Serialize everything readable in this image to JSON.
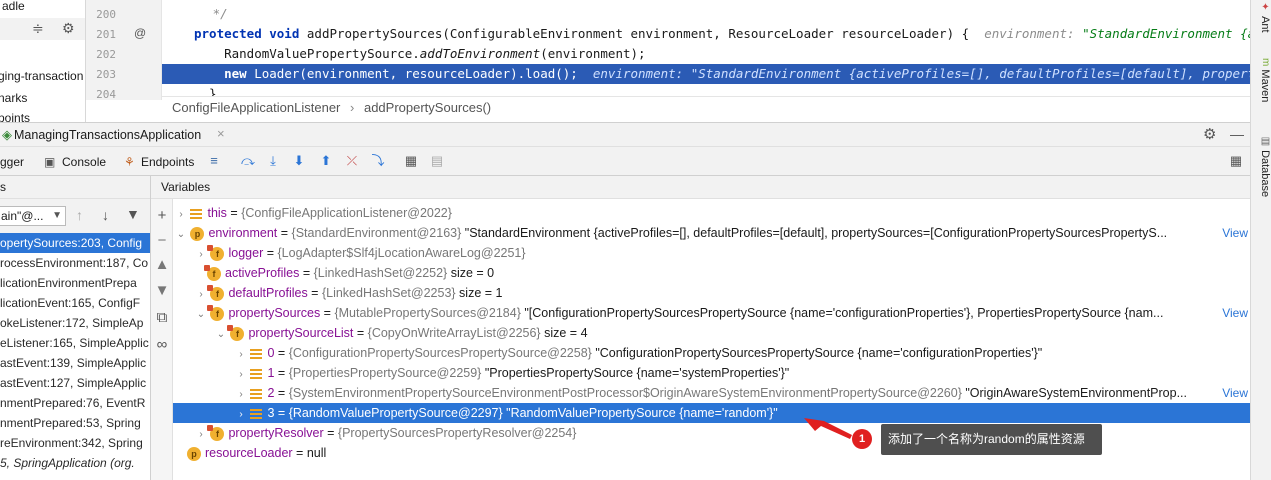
{
  "project_panel": {
    "rows": [
      "adle",
      "",
      "ging-transaction",
      "narks",
      "points"
    ]
  },
  "editor": {
    "line_numbers": [
      "200",
      "201",
      "202",
      "203",
      "204"
    ],
    "gutter_marker": "@",
    "lines": [
      {
        "text": "   */"
      },
      {
        "kw": "protected void ",
        "text": "addPropertySources(ConfigurableEnvironment environment, ResourceLoader resourceLoader) {",
        "hint_label": "environment: ",
        "hint_value": "\"StandardEnvironment {activeProfi"
      },
      {
        "text": "    RandomValuePropertySource.",
        "italic": "addToEnvironment",
        "tail": "(environment);"
      },
      {
        "kw": "    new ",
        "text": "Loader(environment, resourceLoader).load();",
        "hint": "  environment: \"StandardEnvironment {activeProfiles=[], defaultProfiles=[default], propertySources=["
      },
      {
        "text": "  }"
      }
    ]
  },
  "breadcrumb": {
    "class": "ConfigFileApplicationListener",
    "method": "addPropertySources()"
  },
  "right_bar": {
    "tabs": [
      "Ant",
      "Maven",
      "Database"
    ]
  },
  "run_tab": {
    "title": "ManagingTransactionsApplication"
  },
  "toolbar": {
    "debugger_label": "gger",
    "console_label": "Console",
    "endpoints_label": "Endpoints"
  },
  "frames_panel": {
    "header": "s",
    "thread_select": "ain\"@...",
    "frames": [
      "opertySources:203, Config",
      "rocessEnvironment:187, Co",
      "licationEnvironmentPrepa",
      "licationEvent:165, ConfigF",
      "okeListener:172, SimpleAp",
      "eListener:165, SimpleApplic",
      "astEvent:139, SimpleApplic",
      "astEvent:127, SimpleApplic",
      "nmentPrepared:76, EventR",
      "nmentPrepared:53, Spring",
      "reEnvironment:342, Spring",
      "5, SpringApplication (org."
    ]
  },
  "variables": {
    "header": "Variables",
    "view_label": "View",
    "rows": [
      {
        "name": "this",
        "eq": " = ",
        "ref": "{ConfigFileApplicationListener@2022}",
        "val": ""
      },
      {
        "name": "environment",
        "eq": " = ",
        "ref": "{StandardEnvironment@2163}",
        "val": " \"StandardEnvironment {activeProfiles=[], defaultProfiles=[default], propertySources=[ConfigurationPropertySourcesPropertyS..."
      },
      {
        "name": "logger",
        "eq": " = ",
        "ref": "{LogAdapter$Slf4jLocationAwareLog@2251}",
        "val": ""
      },
      {
        "name": "activeProfiles",
        "eq": " = ",
        "ref": "{LinkedHashSet@2252}",
        "val": "  size = 0"
      },
      {
        "name": "defaultProfiles",
        "eq": " = ",
        "ref": "{LinkedHashSet@2253}",
        "val": "  size = 1"
      },
      {
        "name": "propertySources",
        "eq": " = ",
        "ref": "{MutablePropertySources@2184}",
        "val": " \"[ConfigurationPropertySourcesPropertySource {name='configurationProperties'}, PropertiesPropertySource {nam..."
      },
      {
        "name": "propertySourceList",
        "eq": " = ",
        "ref": "{CopyOnWriteArrayList@2256}",
        "val": "  size = 4"
      },
      {
        "name": "0",
        "eq": " = ",
        "ref": "{ConfigurationPropertySourcesPropertySource@2258}",
        "val": " \"ConfigurationPropertySourcesPropertySource {name='configurationProperties'}\""
      },
      {
        "name": "1",
        "eq": " = ",
        "ref": "{PropertiesPropertySource@2259}",
        "val": " \"PropertiesPropertySource {name='systemProperties'}\""
      },
      {
        "name": "2",
        "eq": " = ",
        "ref": "{SystemEnvironmentPropertySourceEnvironmentPostProcessor$OriginAwareSystemEnvironmentPropertySource@2260}",
        "val": " \"OriginAwareSystemEnvironmentProp..."
      },
      {
        "name": "3",
        "eq": " = ",
        "ref": "{RandomValuePropertySource@2297}",
        "val": " \"RandomValuePropertySource {name='random'}\""
      },
      {
        "name": "propertyResolver",
        "eq": " = ",
        "ref": "{PropertySourcesPropertyResolver@2254}",
        "val": ""
      },
      {
        "name": "resourceLoader",
        "eq": " = ",
        "ref": "",
        "val": "null"
      }
    ]
  },
  "annotation": {
    "number": "1",
    "text": "添加了一个名称为random的属性资源",
    "color": "#e02020"
  }
}
